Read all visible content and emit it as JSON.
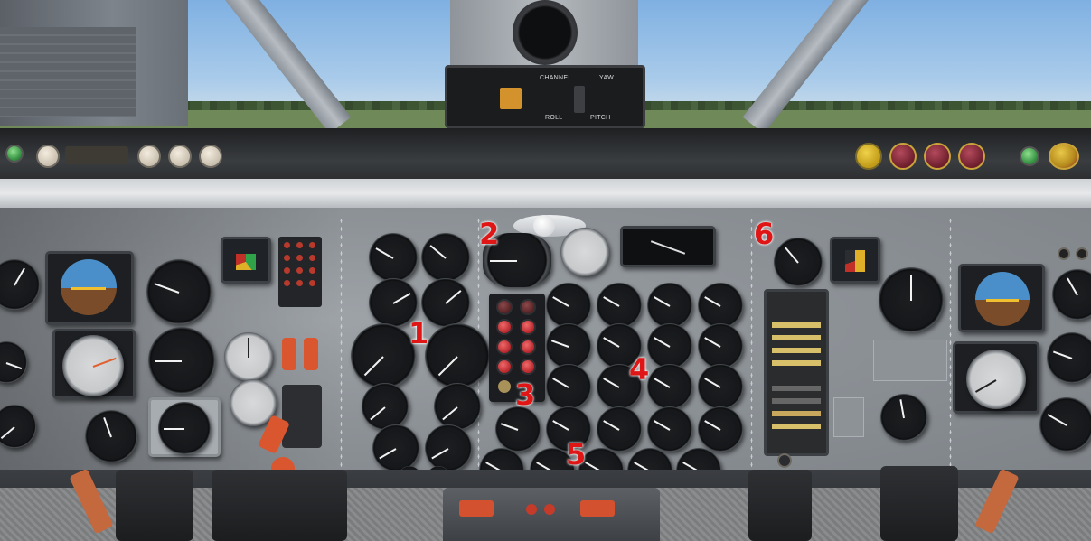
{
  "scene": {
    "sky_color": "#a9cbea",
    "panel_color": "#8e9398",
    "callout_color": "#e01515"
  },
  "autopilot": {
    "labels": {
      "channel": "CHANNEL",
      "yaw": "YAW",
      "roll": "ROLL",
      "pitch": "PITCH"
    }
  },
  "callouts": [
    "1",
    "2",
    "3",
    "4",
    "5",
    "6"
  ],
  "lamps": {
    "annunciator_active": "#b8262b",
    "glareshield_red": "#6d1e2c",
    "glareshield_yellow": "#c09a18"
  },
  "icons": [
    "engine-gauge-icon",
    "attitude-indicator-icon",
    "annunciator-lamp-icon",
    "compass-icon",
    "knob-icon"
  ]
}
